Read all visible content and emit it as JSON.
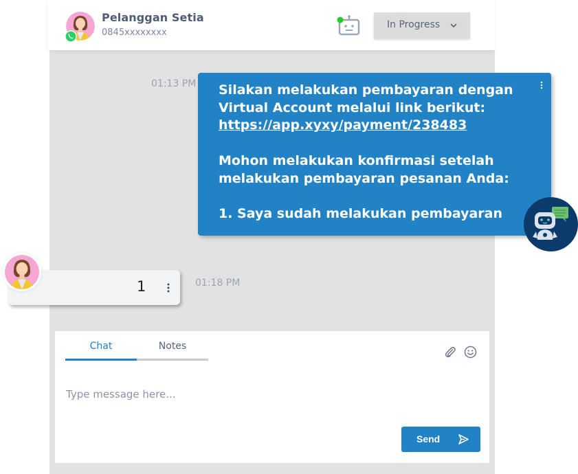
{
  "header": {
    "contact_name": "Pelanggan Setia",
    "contact_phone": "0845xxxxxxxx",
    "channel_icon": "whatsapp-icon",
    "bot_icon": "robot-icon",
    "bot_status_color": "#22cc22",
    "status_select": {
      "value": "In Progress",
      "icon": "chevron-down-icon"
    }
  },
  "messages": [
    {
      "direction": "outgoing",
      "time": "01:13 PM",
      "line1": "Silakan melakukan pembayaran dengan\nVirtual Account melalui link berikut:\n",
      "link": "https://app.xyxy/payment/238483",
      "line2": "\n\nMohon melakukan konfirmasi setelah\nmelakukan pembayaran pesanan Anda:\n\n1. Saya sudah melakukan pembayaran",
      "menu_icon": "more-vertical-icon",
      "sender_icon": "chatbot-icon"
    },
    {
      "direction": "incoming",
      "time": "01:18 PM",
      "text": "1",
      "menu_icon": "more-vertical-icon"
    }
  ],
  "composer": {
    "tabs": [
      {
        "label": "Chat",
        "active": true
      },
      {
        "label": "Notes",
        "active": false
      }
    ],
    "placeholder": "Type message here...",
    "value": "",
    "send_label": "Send",
    "attach_icon": "paperclip-icon",
    "emoji_icon": "smiley-icon",
    "send_icon": "send-icon"
  },
  "colors": {
    "accent": "#2282c6",
    "panel_bg": "#e2e2e2",
    "bot_avatar_bg": "#0c3a6b"
  }
}
